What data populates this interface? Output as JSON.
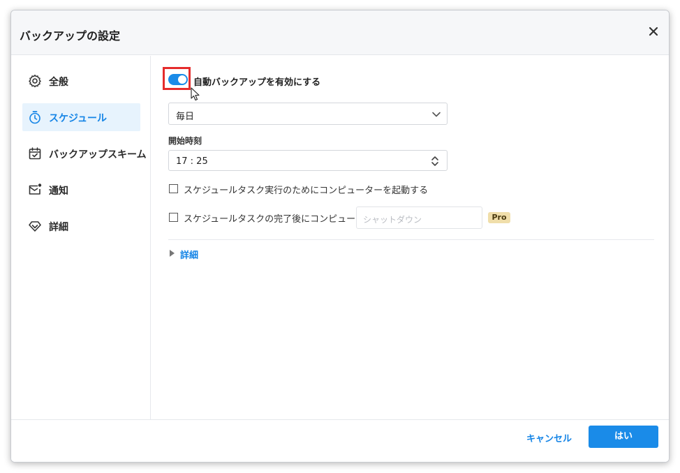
{
  "dialog": {
    "title": "バックアップの設定",
    "close_icon": "close-icon"
  },
  "sidebar": {
    "items": [
      {
        "label": "全般",
        "icon": "gear-icon",
        "active": false
      },
      {
        "label": "スケジュール",
        "icon": "timer-icon",
        "active": true
      },
      {
        "label": "バックアップスキーム",
        "icon": "calendar-check-icon",
        "active": false
      },
      {
        "label": "通知",
        "icon": "mail-notification-icon",
        "active": false
      },
      {
        "label": "詳細",
        "icon": "diamond-icon",
        "active": false
      }
    ]
  },
  "schedule": {
    "auto_backup_label": "自動バックアップを有効にする",
    "auto_backup_enabled": true,
    "frequency_value": "毎日",
    "start_time_label": "開始時刻",
    "start_time_value": "17 : 25",
    "wake_checkbox_label": "スケジュールタスク実行のためにコンピューターを起動する",
    "wake_checked": false,
    "after_checkbox_label": "スケジュールタスクの完了後にコンピューターを",
    "after_checked": false,
    "after_action_placeholder": "シャットダウン",
    "pro_badge": "Pro",
    "details_label": "詳細"
  },
  "footer": {
    "cancel_label": "キャンセル",
    "ok_label": "はい"
  },
  "colors": {
    "accent": "#1a8be8",
    "link": "#1484e6",
    "highlight_box": "#e52c2c",
    "active_nav_bg": "#e7f3fd",
    "pro_badge_bg": "#f0deaa"
  }
}
